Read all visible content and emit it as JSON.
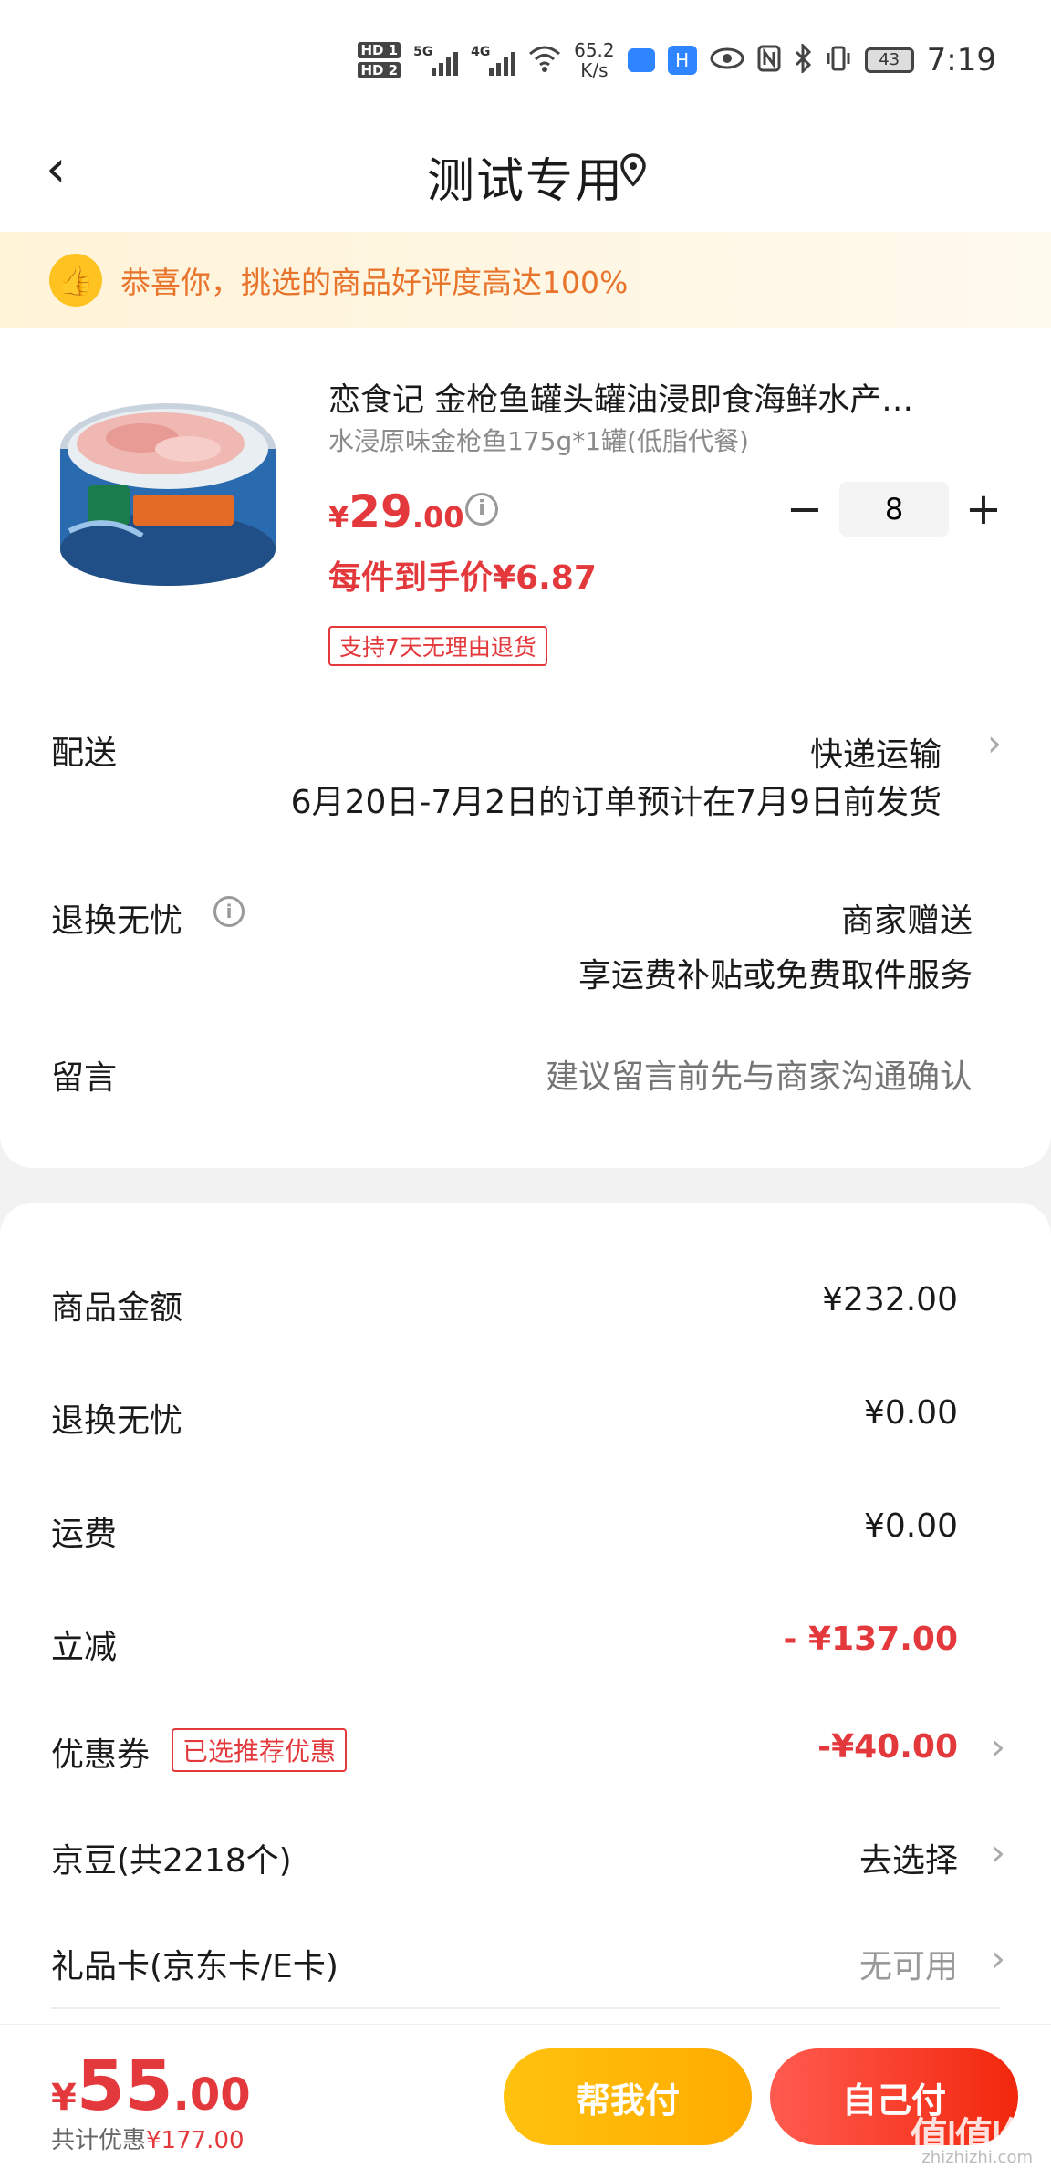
{
  "status_bar": {
    "hd1": "HD 1",
    "hd2": "HD 2",
    "net1": "5G",
    "net2": "4G",
    "speed_value": "65.2",
    "speed_unit": "K/s",
    "battery": "43",
    "time": "7:19"
  },
  "header": {
    "back_icon": "‹",
    "title": "测试专用"
  },
  "banner": {
    "text": "恭喜你，挑选的商品好评度高达100%"
  },
  "product": {
    "title": "恋食记 金枪鱼罐头罐油浸即食海鲜水产…",
    "sku": "水浸原味金枪鱼175g*1罐(低脂代餐)",
    "price_currency": "¥",
    "price_int": "29",
    "price_dec": ".00",
    "quantity": "8",
    "unit_price": "每件到手价¥6.87",
    "return_tag": "支持7天无理由退货",
    "label_colors": {
      "tuna_can": "#e46b26",
      "tuna_meat": "#f0b8b2"
    }
  },
  "shipping": {
    "label": "配送",
    "method": "快递运输",
    "note": "6月20日-7月2日的订单预计在7月9日前发货"
  },
  "returns": {
    "label": "退换无忧",
    "value": "商家赠送",
    "desc": "享运费补贴或免费取件服务"
  },
  "message": {
    "label": "留言",
    "placeholder": "建议留言前先与商家沟通确认"
  },
  "costs": {
    "goods_label": "商品金额",
    "goods_value": "¥232.00",
    "returns_label": "退换无忧",
    "returns_value": "¥0.00",
    "freight_label": "运费",
    "freight_value": "¥0.00",
    "discount_label": "立减",
    "discount_value": "- ¥137.00",
    "coupon_label": "优惠券",
    "coupon_tag": "已选推荐优惠",
    "coupon_value": "-¥40.00",
    "jdou_label": "京豆(共2218个)",
    "jdou_value": "去选择",
    "giftcard_label": "礼品卡(京东卡/E卡)",
    "giftcard_value": "无可用"
  },
  "bottom": {
    "total_currency": "¥",
    "total_int": "55",
    "total_dec": ".00",
    "saved_prefix": "共计优惠",
    "saved_value": "¥177.00",
    "help_pay": "帮我付",
    "self_pay": "自己付",
    "watermark": "值|值|值",
    "watermark_sub": "zhizhizhi.com"
  },
  "colors": {
    "accent_red": "#e4393c",
    "banner_orange": "#e8732a",
    "help_button": "#ffb400",
    "self_button": "#f2270c"
  }
}
